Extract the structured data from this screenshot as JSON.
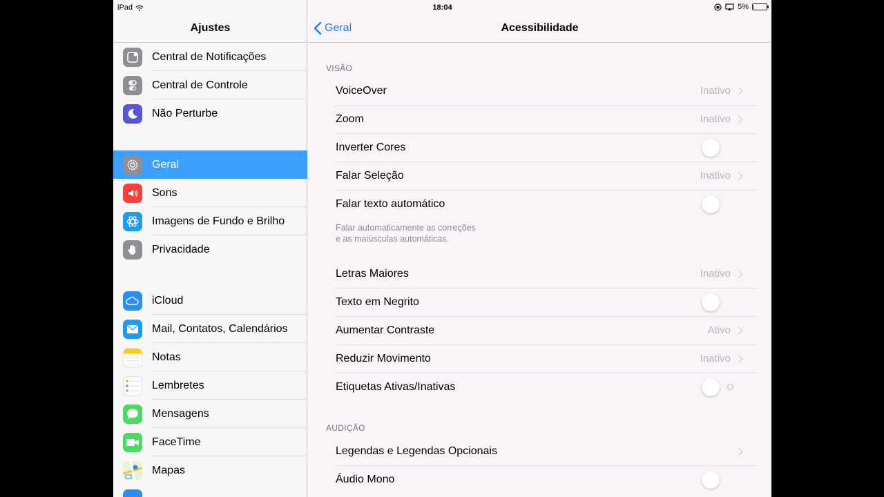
{
  "status_bar": {
    "device": "iPad",
    "time": "18:04",
    "battery": "5%"
  },
  "sidebar": {
    "title": "Ajustes",
    "items": [
      {
        "label": "Central de Notificações",
        "icon": "notifications-icon",
        "color": "#8e8e93"
      },
      {
        "label": "Central de Controle",
        "icon": "control-center-icon",
        "color": "#8e8e93"
      },
      {
        "label": "Não Perturbe",
        "icon": "moon-icon",
        "color": "#5856d6"
      },
      {
        "label": "Geral",
        "icon": "gear-icon",
        "color": "#8e8e93",
        "selected": true
      },
      {
        "label": "Sons",
        "icon": "speaker-icon",
        "color": "#fc3d39"
      },
      {
        "label": "Imagens de Fundo e Brilho",
        "icon": "wallpaper-icon",
        "color": "#1e9bf0"
      },
      {
        "label": "Privacidade",
        "icon": "hand-icon",
        "color": "#8e8e93"
      },
      {
        "label": "iCloud",
        "icon": "cloud-icon",
        "color": "#2a8ef5"
      },
      {
        "label": "Mail, Contatos, Calendários",
        "icon": "mail-icon",
        "color": "#1e9bf0"
      },
      {
        "label": "Notas",
        "icon": "notes-icon",
        "color": "#ffcc00"
      },
      {
        "label": "Lembretes",
        "icon": "reminders-icon",
        "color": "#ffffff"
      },
      {
        "label": "Mensagens",
        "icon": "messages-icon",
        "color": "#4cd964"
      },
      {
        "label": "FaceTime",
        "icon": "facetime-icon",
        "color": "#4cd964"
      },
      {
        "label": "Mapas",
        "icon": "maps-icon",
        "color": "#e8e4d8"
      }
    ]
  },
  "main": {
    "back_label": "Geral",
    "title": "Acessibilidade",
    "sections": {
      "vision": "VISÃO",
      "hearing": "AUDIÇÃO"
    },
    "rows": {
      "voiceover": {
        "label": "VoiceOver",
        "value": "Inativo"
      },
      "zoom": {
        "label": "Zoom",
        "value": "Inativo"
      },
      "invert": {
        "label": "Inverter Cores",
        "on": false
      },
      "speak_selection": {
        "label": "Falar Seleção",
        "value": "Inativo"
      },
      "speak_auto": {
        "label": "Falar texto automático",
        "on": false
      },
      "larger_text": {
        "label": "Letras Maiores",
        "value": "Inativo"
      },
      "bold_text": {
        "label": "Texto em Negrito",
        "on": false
      },
      "contrast": {
        "label": "Aumentar Contraste",
        "value": "Ativo"
      },
      "reduce_motion": {
        "label": "Reduzir Movimento",
        "value": "Inativo"
      },
      "onoff_labels": {
        "label": "Etiquetas Ativas/Inativas",
        "on": false
      },
      "subtitles": {
        "label": "Legendas e Legendas Opcionais"
      },
      "mono_audio": {
        "label": "Áudio Mono",
        "on": false
      }
    },
    "footnote_line1": "Falar automaticamente as correções",
    "footnote_line2": "e as maiúsculas automáticas."
  }
}
